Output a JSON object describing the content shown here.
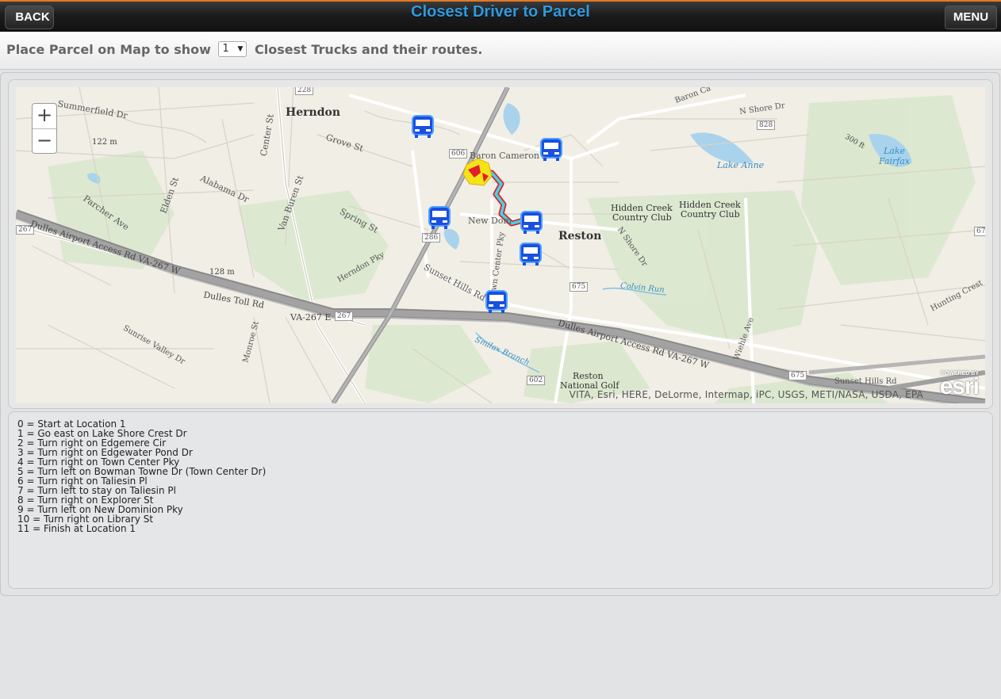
{
  "header": {
    "title": "Closest Driver to Parcel",
    "back_label": "BACK",
    "menu_label": "MENU"
  },
  "subbar": {
    "prefix": "Place Parcel on Map to show",
    "select_value": "1",
    "suffix": "Closest Trucks and their routes."
  },
  "map": {
    "zoom_in": "+",
    "zoom_out": "−",
    "attribution": "VITA, Esri, HERE, DeLorme, Intermap, iPC, USGS, METI/NASA, USDA, EPA",
    "powered_by": "POWERED BY",
    "esri_logo": "esri",
    "places": {
      "herndon": "Herndon",
      "reston": "Reston"
    },
    "labels": {
      "summerfield": "Summerfield Dr",
      "grove": "Grove St",
      "baron_cameron": "Baron Cameron Av",
      "alabama": "Alabama Dr",
      "elden": "Elden St",
      "van_buren": "Van Buren St",
      "spring": "Spring St",
      "center": "Center St",
      "parcher": "Parcher Ave",
      "dulles_access_w": "Dulles Airport Access Rd  VA-267 W",
      "dulles_toll": "Dulles Toll Rd",
      "va267e": "VA-267 E",
      "dulles_access_e": "Dulles Airport Access Rd  VA-267 W",
      "herndon_pky": "Herndon Pky",
      "sunset_hills": "Sunset Hills Rd",
      "new_dominion": "New Dom",
      "town_center": "Town Center Pky",
      "hidden_creek_1": "Hidden Creek",
      "hidden_creek_1b": "Country Club",
      "hidden_creek_2": "Hidden Creek",
      "hidden_creek_2b": "Country Club",
      "lake_anne": "Lake Anne",
      "lake_fairfax": "Lake\nFairfax",
      "colvin_run": "Colvin Run",
      "n_shore": "N Shore Dr",
      "smilax": "Smilax Branch",
      "reston_golf": "Reston",
      "reston_golf2": "National Golf",
      "sunrise_valley": "Sunrise Valley Dr",
      "monroe": "Monroe St",
      "wiehle": "Wiehle Ave",
      "hunting_crest": "Hunting Crest",
      "elev1": "122 m",
      "elev2": "128 m",
      "elev3": "300 ft",
      "sunset_hills_e": "Sunset Hills Rd",
      "lake_shore": "N Shore Dr",
      "baron_c_ne": "Baron Ca",
      "r228": "228",
      "r606": "606",
      "r828": "828",
      "r286": "286",
      "r267a": "267",
      "r267b": "267",
      "r675a": "675",
      "r675b": "675",
      "r602": "602",
      "r67": "67"
    }
  },
  "directions": [
    "0 = Start at Location 1",
    "1 = Go east on Lake Shore Crest Dr",
    "2 = Turn right on Edgemere Cir",
    "3 = Turn right on Edgewater Pond Dr",
    "4 = Turn right on Town Center Pky",
    "5 = Turn left on Bowman Towne Dr (Town Center Dr)",
    "6 = Turn right on Taliesin Pl",
    "7 = Turn left to stay on Taliesin Pl",
    "8 = Turn right on Explorer St",
    "9 = Turn left on New Dominion Pky",
    "10 = Turn right on Library St",
    "11 = Finish at Location 1"
  ],
  "colors": {
    "title": "#2f9ae0",
    "route_outline": "#e0202a",
    "route_fill": "#3fd6e6",
    "truck": "#1a4fe0",
    "parcel": "#f5e31a"
  }
}
